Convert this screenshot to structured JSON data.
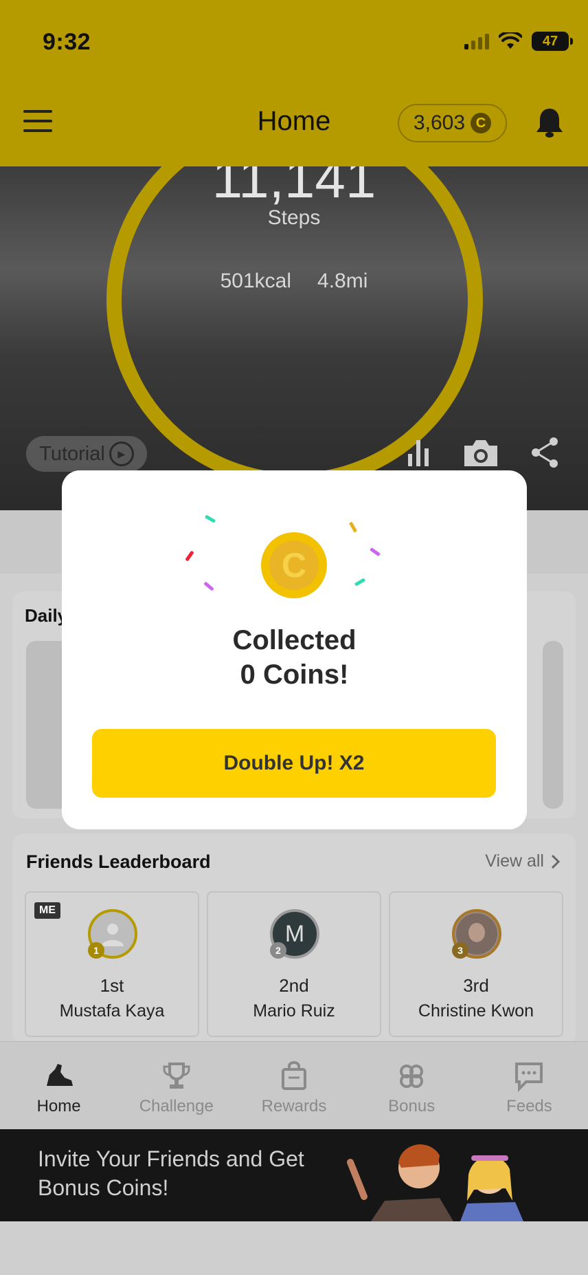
{
  "status_bar": {
    "time": "9:32",
    "battery": "47"
  },
  "header": {
    "title": "Home",
    "coins": "3,603",
    "coin_symbol": "C"
  },
  "hero": {
    "steps": "11,141",
    "steps_label": "Steps",
    "kcal": "501kcal",
    "distance": "4.8mi",
    "tutorial_label": "Tutorial"
  },
  "daily": {
    "title": "Daily"
  },
  "leaderboard": {
    "title": "Friends Leaderboard",
    "view_all": "View all",
    "me_badge": "ME",
    "entries": [
      {
        "rank": "1st",
        "name": "Mustafa Kaya",
        "medal": "1",
        "avatar_initial": ""
      },
      {
        "rank": "2nd",
        "name": "Mario Ruiz",
        "medal": "2",
        "avatar_initial": "M"
      },
      {
        "rank": "3rd",
        "name": "Christine Kwon",
        "medal": "3",
        "avatar_initial": ""
      }
    ]
  },
  "tabs": [
    {
      "label": "Home",
      "icon": "shoe-icon",
      "active": true
    },
    {
      "label": "Challenge",
      "icon": "trophy-icon",
      "active": false
    },
    {
      "label": "Rewards",
      "icon": "bag-icon",
      "active": false
    },
    {
      "label": "Bonus",
      "icon": "clover-icon",
      "active": false
    },
    {
      "label": "Feeds",
      "icon": "chat-icon",
      "active": false
    }
  ],
  "banner": {
    "text": "Invite Your Friends and Get Bonus Coins!"
  },
  "modal": {
    "title_line1": "Collected",
    "title_line2": "0 Coins!",
    "coin_symbol": "C",
    "button_label": "Double Up! X2"
  },
  "colors": {
    "brand_yellow": "#ffd000",
    "header_bg": "#b59a00",
    "ring": "#b59a00"
  }
}
